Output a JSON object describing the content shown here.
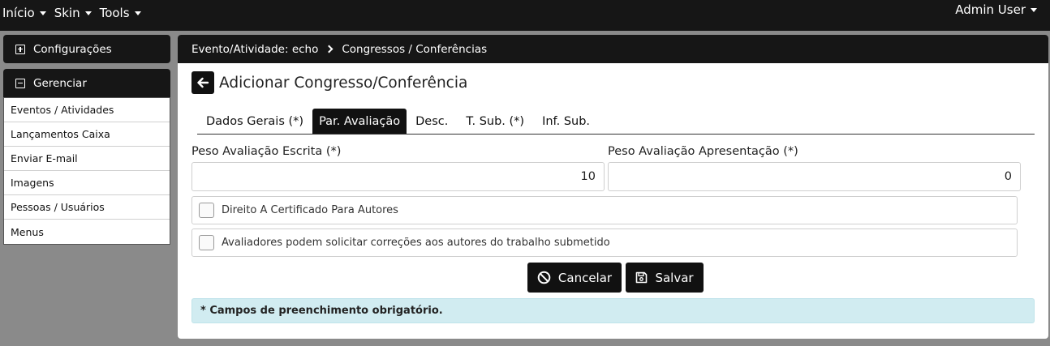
{
  "topnav": {
    "menu": [
      {
        "label": "Início"
      },
      {
        "label": "Skin"
      },
      {
        "label": "Tools"
      }
    ],
    "user_label": "Admin User"
  },
  "sidebar": {
    "config_title": "Configurações",
    "manage_title": "Gerenciar",
    "items": [
      {
        "label": "Eventos / Atividades"
      },
      {
        "label": "Lançamentos Caixa"
      },
      {
        "label": "Enviar E-mail"
      },
      {
        "label": "Imagens"
      },
      {
        "label": "Pessoas / Usuários"
      },
      {
        "label": "Menus"
      }
    ]
  },
  "breadcrumb": {
    "event": "Evento/Atividade: echo",
    "section": "Congressos / Conferências"
  },
  "page_title": "Adicionar Congresso/Conferência",
  "tabs": [
    {
      "label": "Dados Gerais (*)"
    },
    {
      "label": "Par. Avaliação"
    },
    {
      "label": "Desc."
    },
    {
      "label": "T. Sub. (*)"
    },
    {
      "label": "Inf. Sub."
    }
  ],
  "active_tab": "Par. Avaliação",
  "form": {
    "written_label": "Peso Avaliação Escrita (*)",
    "written_value": "10",
    "presentation_label": "Peso Avaliação Apresentação (*)",
    "presentation_value": "0",
    "cert_label": "Direito A Certificado Para Autores",
    "corrections_label": "Avaliadores podem solicitar correções aos autores do trabalho submetido"
  },
  "actions": {
    "cancel_label": "Cancelar",
    "save_label": "Salvar"
  },
  "notice": "* Campos de preenchimento obrigatório."
}
